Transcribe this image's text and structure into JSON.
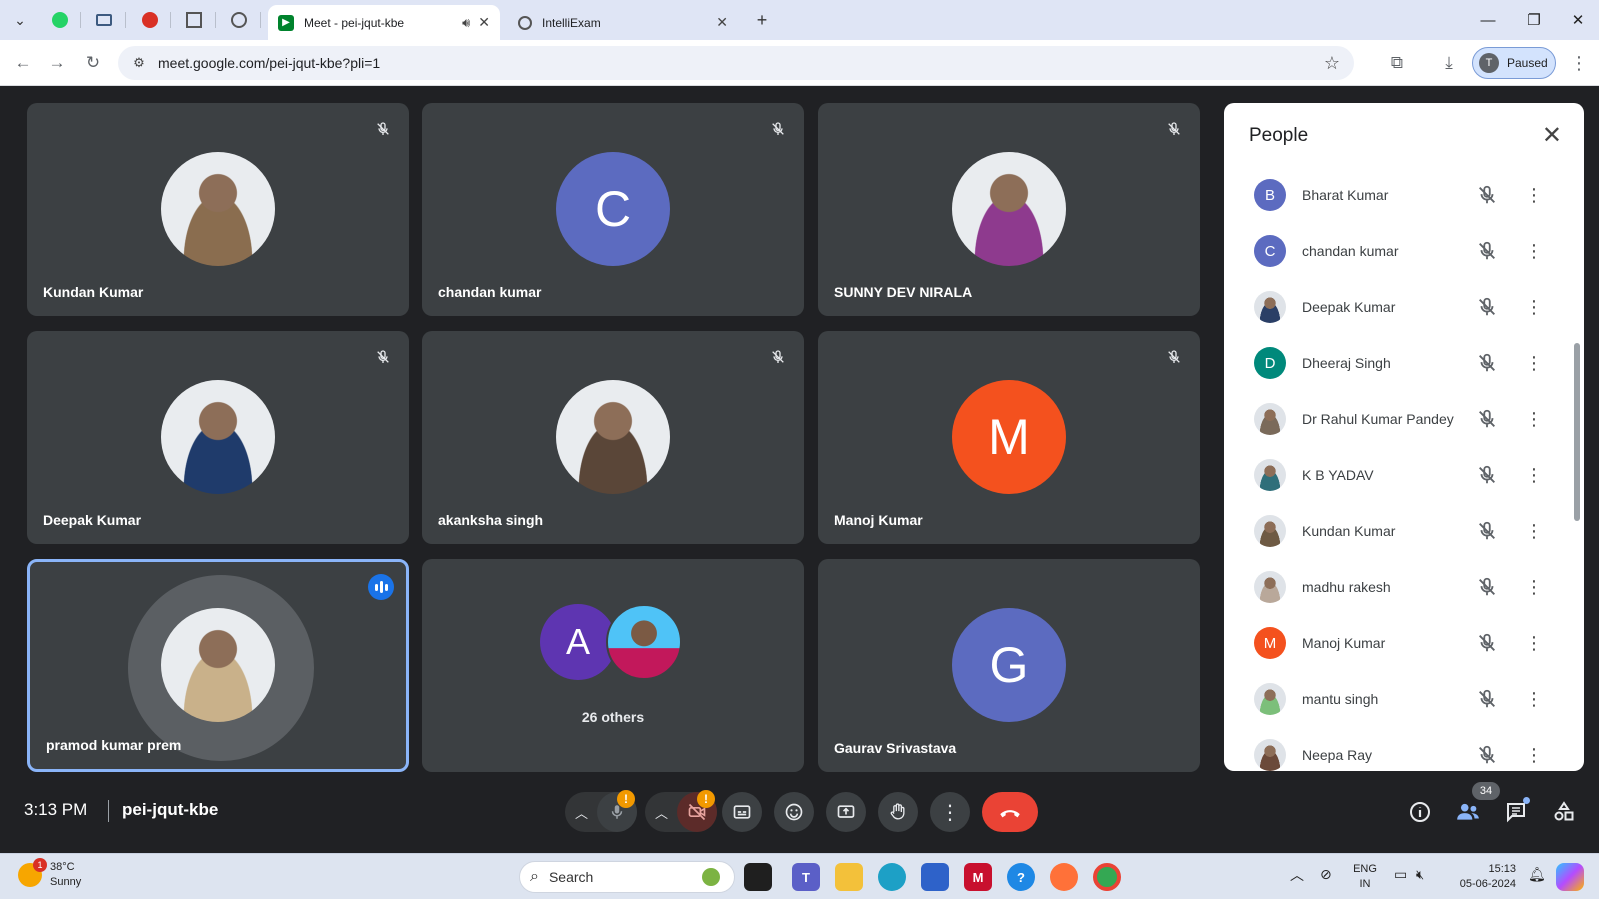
{
  "browser": {
    "tabs": [
      {
        "title": "Meet - pei-jqut-kbe",
        "active": true
      },
      {
        "title": "IntelliExam",
        "active": false
      }
    ],
    "url": "meet.google.com/pei-jqut-kbe?pli=1",
    "profile_initial": "T",
    "profile_status": "Paused"
  },
  "meet": {
    "time": "3:13 PM",
    "meeting_code": "pei-jqut-kbe",
    "tiles": [
      {
        "name": "Kundan Kumar",
        "muted": true,
        "avatar": "photo",
        "color": "#8a6d4f"
      },
      {
        "name": "chandan kumar",
        "muted": true,
        "avatar": "letter",
        "letter": "C",
        "color": "#5c6bc0"
      },
      {
        "name": "SUNNY DEV NIRALA",
        "muted": true,
        "avatar": "photo",
        "color": "#8e3a8e"
      },
      {
        "name": "Deepak Kumar",
        "muted": true,
        "avatar": "photo",
        "color": "#1f3b6b"
      },
      {
        "name": "akanksha singh",
        "muted": true,
        "avatar": "photo",
        "color": "#5a4638"
      },
      {
        "name": "Manoj Kumar",
        "muted": true,
        "avatar": "letter",
        "letter": "M",
        "color": "#f4511e"
      },
      {
        "name": "pramod kumar prem",
        "muted": false,
        "speaking": true,
        "avatar": "photo",
        "color": "#c9b18a"
      },
      {
        "name": "26 others",
        "muted": false,
        "avatar": "others",
        "letter": "A",
        "color": "#5e35b1"
      },
      {
        "name": "Gaurav Srivastava",
        "muted": false,
        "avatar": "letter",
        "letter": "G",
        "color": "#5c6bc0"
      }
    ],
    "people_count": "34",
    "warning_mark": "!"
  },
  "people_panel": {
    "title": "People",
    "participants": [
      {
        "name": "Bharat Kumar",
        "avatar": "letter",
        "letter": "B",
        "color": "#5c6bc0"
      },
      {
        "name": "chandan kumar",
        "avatar": "letter",
        "letter": "C",
        "color": "#5c6bc0"
      },
      {
        "name": "Deepak Kumar",
        "avatar": "photo",
        "color": "#2a3f66"
      },
      {
        "name": "Dheeraj Singh",
        "avatar": "letter",
        "letter": "D",
        "color": "#00897b"
      },
      {
        "name": "Dr Rahul Kumar Pandey",
        "avatar": "photo",
        "color": "#7a6a5a"
      },
      {
        "name": "K B YADAV",
        "avatar": "photo",
        "color": "#2f6f7a"
      },
      {
        "name": "Kundan Kumar",
        "avatar": "photo",
        "color": "#6e5a44"
      },
      {
        "name": "madhu rakesh",
        "avatar": "photo",
        "color": "#b9a89a"
      },
      {
        "name": "Manoj Kumar",
        "avatar": "letter",
        "letter": "M",
        "color": "#f4511e"
      },
      {
        "name": "mantu singh",
        "avatar": "photo",
        "color": "#7cbf7a"
      },
      {
        "name": "Neepa Ray",
        "avatar": "photo",
        "color": "#6b4a3a"
      }
    ]
  },
  "taskbar": {
    "weather_temp": "38°C",
    "weather_desc": "Sunny",
    "weather_alert": "1",
    "search_label": "Search",
    "lang": "ENG",
    "region": "IN",
    "clock_time": "15:13",
    "clock_date": "05-06-2024"
  }
}
